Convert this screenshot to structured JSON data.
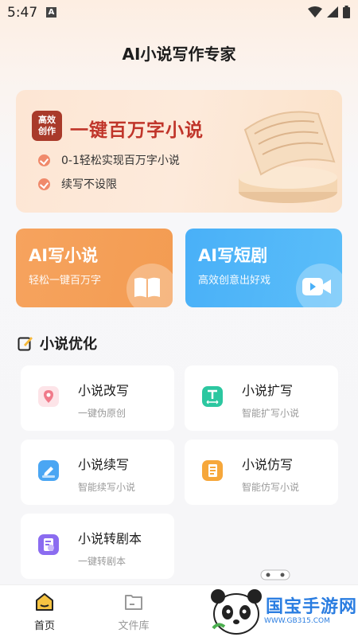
{
  "status_bar": {
    "time": "5:47",
    "notification_badge": "A"
  },
  "app": {
    "title": "AI小说写作专家"
  },
  "hero": {
    "badge_line1": "高效",
    "badge_line2": "创作",
    "title": "一键百万字小说",
    "features": [
      "0-1轻松实现百万字小说",
      "续写不设限"
    ]
  },
  "cards": [
    {
      "title": "AI写小说",
      "subtitle": "轻松一键百万字",
      "icon": "book-icon"
    },
    {
      "title": "AI写短剧",
      "subtitle": "高效创意出好戏",
      "icon": "video-icon"
    }
  ],
  "section": {
    "title": "小说优化"
  },
  "tools": [
    {
      "label": "小说改写",
      "desc": "一键伪原创",
      "icon": "location-pin-icon",
      "color": "#f07a8a"
    },
    {
      "label": "小说扩写",
      "desc": "智能扩写小说",
      "icon": "text-expand-icon",
      "color": "#2cc7a0"
    },
    {
      "label": "小说续写",
      "desc": "智能续写小说",
      "icon": "pen-icon",
      "color": "#4aa6f3"
    },
    {
      "label": "小说仿写",
      "desc": "智能仿写小说",
      "icon": "document-icon",
      "color": "#f6a73b"
    },
    {
      "label": "小说转剧本",
      "desc": "一键转剧本",
      "icon": "script-icon",
      "color": "#8b6cf0"
    }
  ],
  "nav": [
    {
      "label": "首页",
      "active": true
    },
    {
      "label": "文件库",
      "active": false
    }
  ],
  "watermark": {
    "text": "国宝手游网",
    "url": "WWW.GB315.COM"
  },
  "colors": {
    "accent_red": "#c0352a",
    "orange": "#f39c52",
    "blue": "#49b0f8",
    "nav_active": "#222222",
    "nav_inactive": "#999999"
  }
}
